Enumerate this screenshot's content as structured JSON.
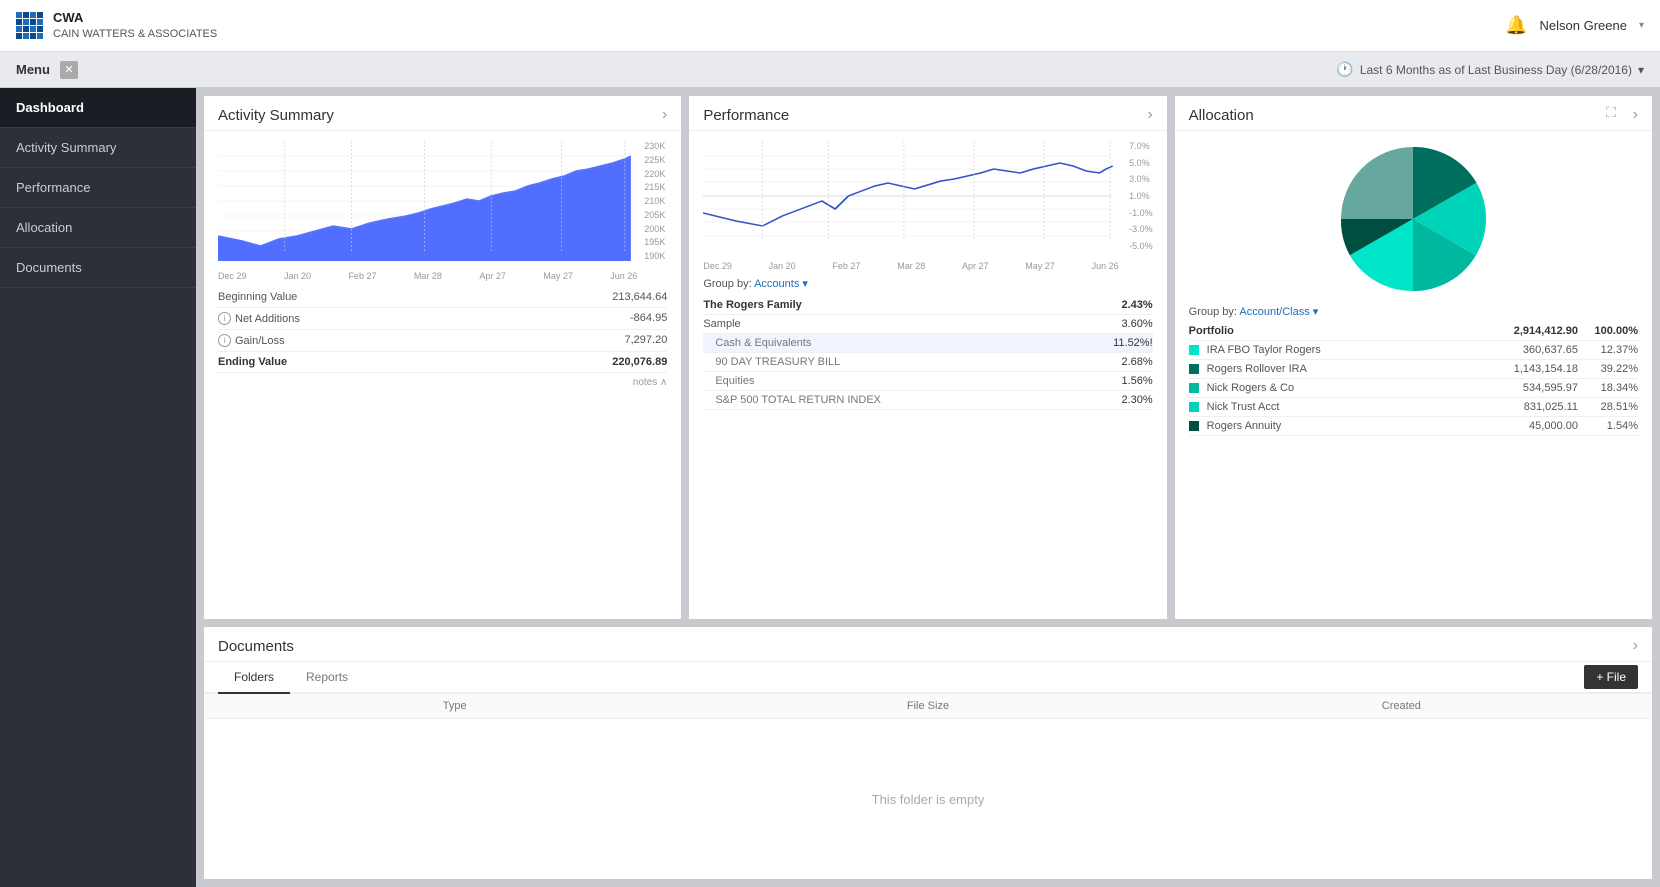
{
  "topbar": {
    "company_short": "CWA",
    "company_full": "CAIN WATTERS & ASSOCIATES",
    "bell_label": "🔔",
    "user_name": "Nelson Greene",
    "dropdown_arrow": "▾"
  },
  "subbar": {
    "menu_label": "Menu",
    "close_label": "✕",
    "date_filter": "Last 6 Months as of Last Business Day (6/28/2016)",
    "dropdown_arrow": "▾"
  },
  "sidebar": {
    "items": [
      {
        "label": "Dashboard",
        "active": true
      },
      {
        "label": "Activity Summary",
        "active": false
      },
      {
        "label": "Performance",
        "active": false
      },
      {
        "label": "Allocation",
        "active": false
      },
      {
        "label": "Documents",
        "active": false
      }
    ]
  },
  "activity_summary": {
    "title": "Activity Summary",
    "arrow": "›",
    "x_labels": [
      "Dec 29",
      "Jan 20",
      "Feb 27",
      "Mar 28",
      "Apr 27",
      "May 27",
      "Jun 26"
    ],
    "y_labels": [
      "230K",
      "225K",
      "220K",
      "215K",
      "210K",
      "205K",
      "200K",
      "195K",
      "190K"
    ],
    "stats": [
      {
        "label": "Beginning Value",
        "value": "213,644.64",
        "bold": false,
        "info": false
      },
      {
        "label": "Net Additions",
        "value": "-864.95",
        "bold": false,
        "info": true
      },
      {
        "label": "Gain/Loss",
        "value": "7,297.20",
        "bold": false,
        "info": true
      },
      {
        "label": "Ending Value",
        "value": "220,076.89",
        "bold": true,
        "info": false
      }
    ],
    "notes_label": "notes ∧"
  },
  "performance": {
    "title": "Performance",
    "arrow": "›",
    "x_labels": [
      "Dec 29",
      "Jan 20",
      "Feb 27",
      "Mar 28",
      "Apr 27",
      "May 27",
      "Jun 26"
    ],
    "y_labels": [
      "7.0%",
      "5.0%",
      "3.0%",
      "1.0%",
      "-1.0%",
      "-3.0%",
      "-5.0%"
    ],
    "group_by_label": "Group by:",
    "group_by_value": "Accounts",
    "rows": [
      {
        "name": "The Rogers Family",
        "pct": "2.43%",
        "bold": true,
        "indent": false,
        "highlighted": false
      },
      {
        "name": "Sample",
        "pct": "3.60%",
        "bold": false,
        "indent": false,
        "highlighted": false
      },
      {
        "name": "Cash & Equivalents",
        "pct": "11.52%!",
        "bold": false,
        "indent": true,
        "highlighted": true
      },
      {
        "name": "90 DAY TREASURY BILL",
        "pct": "2.68%",
        "bold": false,
        "indent": true,
        "highlighted": false
      },
      {
        "name": "Equities",
        "pct": "1.56%",
        "bold": false,
        "indent": true,
        "highlighted": false
      },
      {
        "name": "S&P 500 TOTAL RETURN INDEX",
        "pct": "2.30%",
        "bold": false,
        "indent": true,
        "highlighted": false
      }
    ]
  },
  "allocation": {
    "title": "Allocation",
    "arrow": "›",
    "expand_icon": "⛶",
    "group_by_label": "Group by:",
    "group_by_value": "Account/Class",
    "portfolio_label": "Portfolio",
    "portfolio_value": "2,914,412.90",
    "portfolio_pct": "100.00%",
    "rows": [
      {
        "name": "IRA FBO Taylor Rogers",
        "value": "360,637.65",
        "pct": "12.37%",
        "color": "#00e5c8"
      },
      {
        "name": "Rogers Rollover IRA",
        "value": "1,143,154.18",
        "pct": "39.22%",
        "color": "#006e5e"
      },
      {
        "name": "Nick Rogers & Co",
        "value": "534,595.97",
        "pct": "18.34%",
        "color": "#00b8a0"
      },
      {
        "name": "Nick Trust Acct",
        "value": "831,025.11",
        "pct": "28.51%",
        "color": "#00d4b8"
      },
      {
        "name": "Rogers Annuity",
        "value": "45,000.00",
        "pct": "1.54%",
        "color": "#004d42"
      }
    ]
  },
  "documents": {
    "title": "Documents",
    "arrow": "›",
    "tabs": [
      {
        "label": "Folders",
        "active": true
      },
      {
        "label": "Reports",
        "active": false
      }
    ],
    "add_file_label": "+ File",
    "columns": [
      "Type",
      "File Size",
      "Created"
    ],
    "empty_message": "This folder is empty"
  }
}
